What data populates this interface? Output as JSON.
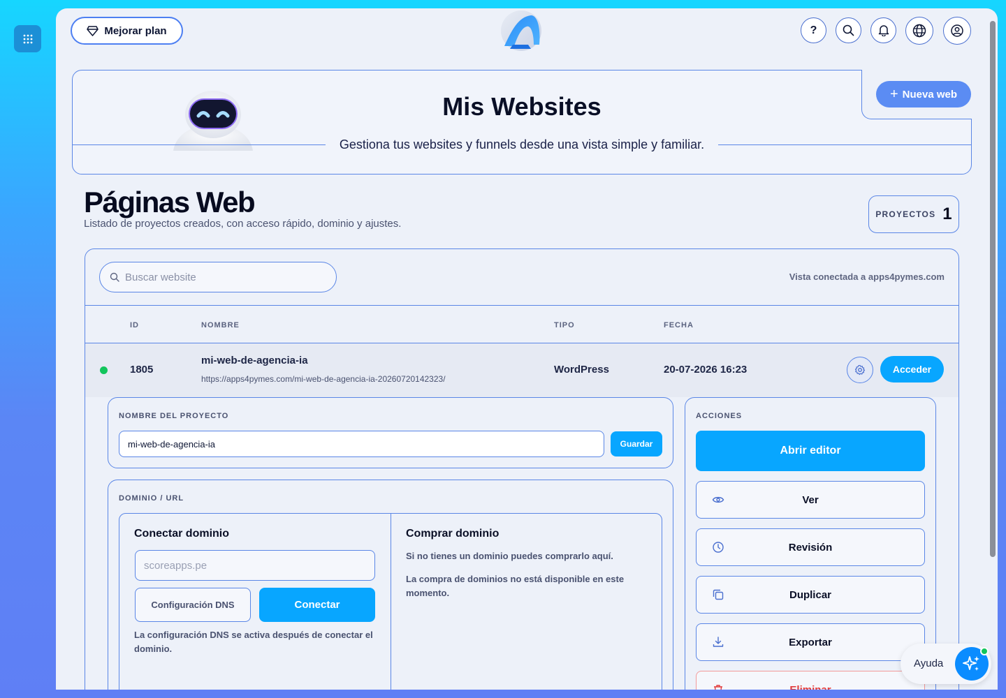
{
  "topbar": {
    "upgrade_label": "Mejorar plan",
    "icons": [
      "help-icon",
      "search-icon",
      "bell-icon",
      "globe-icon",
      "user-icon"
    ],
    "help_glyph": "?"
  },
  "hero": {
    "title": "Mis Websites",
    "subtitle": "Gestiona tus websites y funnels desde una vista simple y familiar.",
    "new_button": "Nueva web",
    "new_button_glyph": "+"
  },
  "page": {
    "title": "Páginas Web",
    "subtitle": "Listado de proyectos creados, con acceso rápido, dominio y ajustes.",
    "projects_label": "PROYECTOS",
    "projects_count": "1"
  },
  "table": {
    "search_placeholder": "Buscar website",
    "connected_note": "Vista conectada a apps4pymes.com",
    "headers": {
      "id": "ID",
      "name": "NOMBRE",
      "type": "TIPO",
      "date": "FECHA"
    },
    "rows": [
      {
        "status": "active",
        "id": "1805",
        "name": "mi-web-de-agencia-ia",
        "url": "https://apps4pymes.com/mi-web-de-agencia-ia-20260720142323/",
        "type": "WordPress",
        "date": "20-07-2026 16:23",
        "access_label": "Acceder"
      }
    ]
  },
  "detail": {
    "name_label": "NOMBRE DEL PROYECTO",
    "name_value": "mi-web-de-agencia-ia",
    "save_label": "Guardar",
    "domain_label": "DOMINIO / URL",
    "connect": {
      "title": "Conectar dominio",
      "placeholder": "scoreapps.pe",
      "dns_label": "Configuración DNS",
      "connect_label": "Conectar",
      "note": "La configuración DNS se activa después de conectar el dominio."
    },
    "buy": {
      "title": "Comprar dominio",
      "note1": "Si no tienes un dominio puedes comprarlo aquí.",
      "note2": "La compra de dominios no está disponible en este momento."
    },
    "actions": {
      "label": "ACCIONES",
      "open_editor": "Abrir editor",
      "view": "Ver",
      "revision": "Revisión",
      "duplicate": "Duplicar",
      "export": "Exportar",
      "delete": "Eliminar"
    }
  },
  "help": {
    "label": "Ayuda"
  },
  "colors": {
    "accent": "#08a6ff",
    "border": "#5a86e6",
    "success": "#12c55c",
    "danger": "#e23a3a"
  }
}
